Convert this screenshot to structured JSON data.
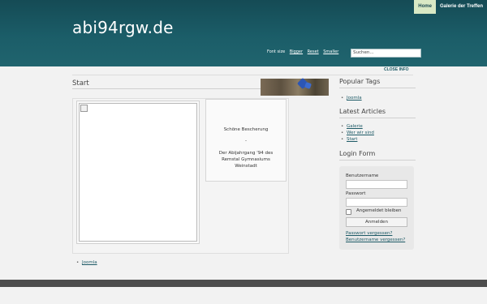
{
  "topnav": {
    "items": [
      {
        "label": "Home"
      },
      {
        "label": "Galerie der Treffen"
      }
    ]
  },
  "site": {
    "title": "abi94rgw.de"
  },
  "fontsize": {
    "label": "Font size",
    "bigger": "Bigger",
    "reset": "Reset",
    "smaller": "Smaller"
  },
  "search": {
    "placeholder": "Suchen..."
  },
  "closeinfo": "CLOSE INFO",
  "main": {
    "heading": "Start",
    "article": {
      "line1": "Schöne Bescherung",
      "line2": "-",
      "line3": "Der Abijahrgang '94 des Remstal Gymnasiums Weinstadt"
    },
    "tags": [
      "Joomla"
    ]
  },
  "sidebar": {
    "popular_tags": {
      "title": "Popular Tags",
      "items": [
        "Joomla"
      ]
    },
    "latest": {
      "title": "Latest Articles",
      "items": [
        "Galerie",
        "Wer wir sind",
        "Start"
      ]
    },
    "login": {
      "title": "Login Form",
      "username_label": "Benutzername",
      "password_label": "Passwort",
      "remember_label": "Angemeldet bleiben",
      "button": "Anmelden",
      "forgot_password": "Passwort vergessen?",
      "forgot_username": "Benutzername vergessen?"
    }
  },
  "colors": {
    "header": "#1b5d68",
    "active_nav": "#d9e9c5",
    "link": "#1d5a66",
    "footer": "#4d4d4d"
  }
}
